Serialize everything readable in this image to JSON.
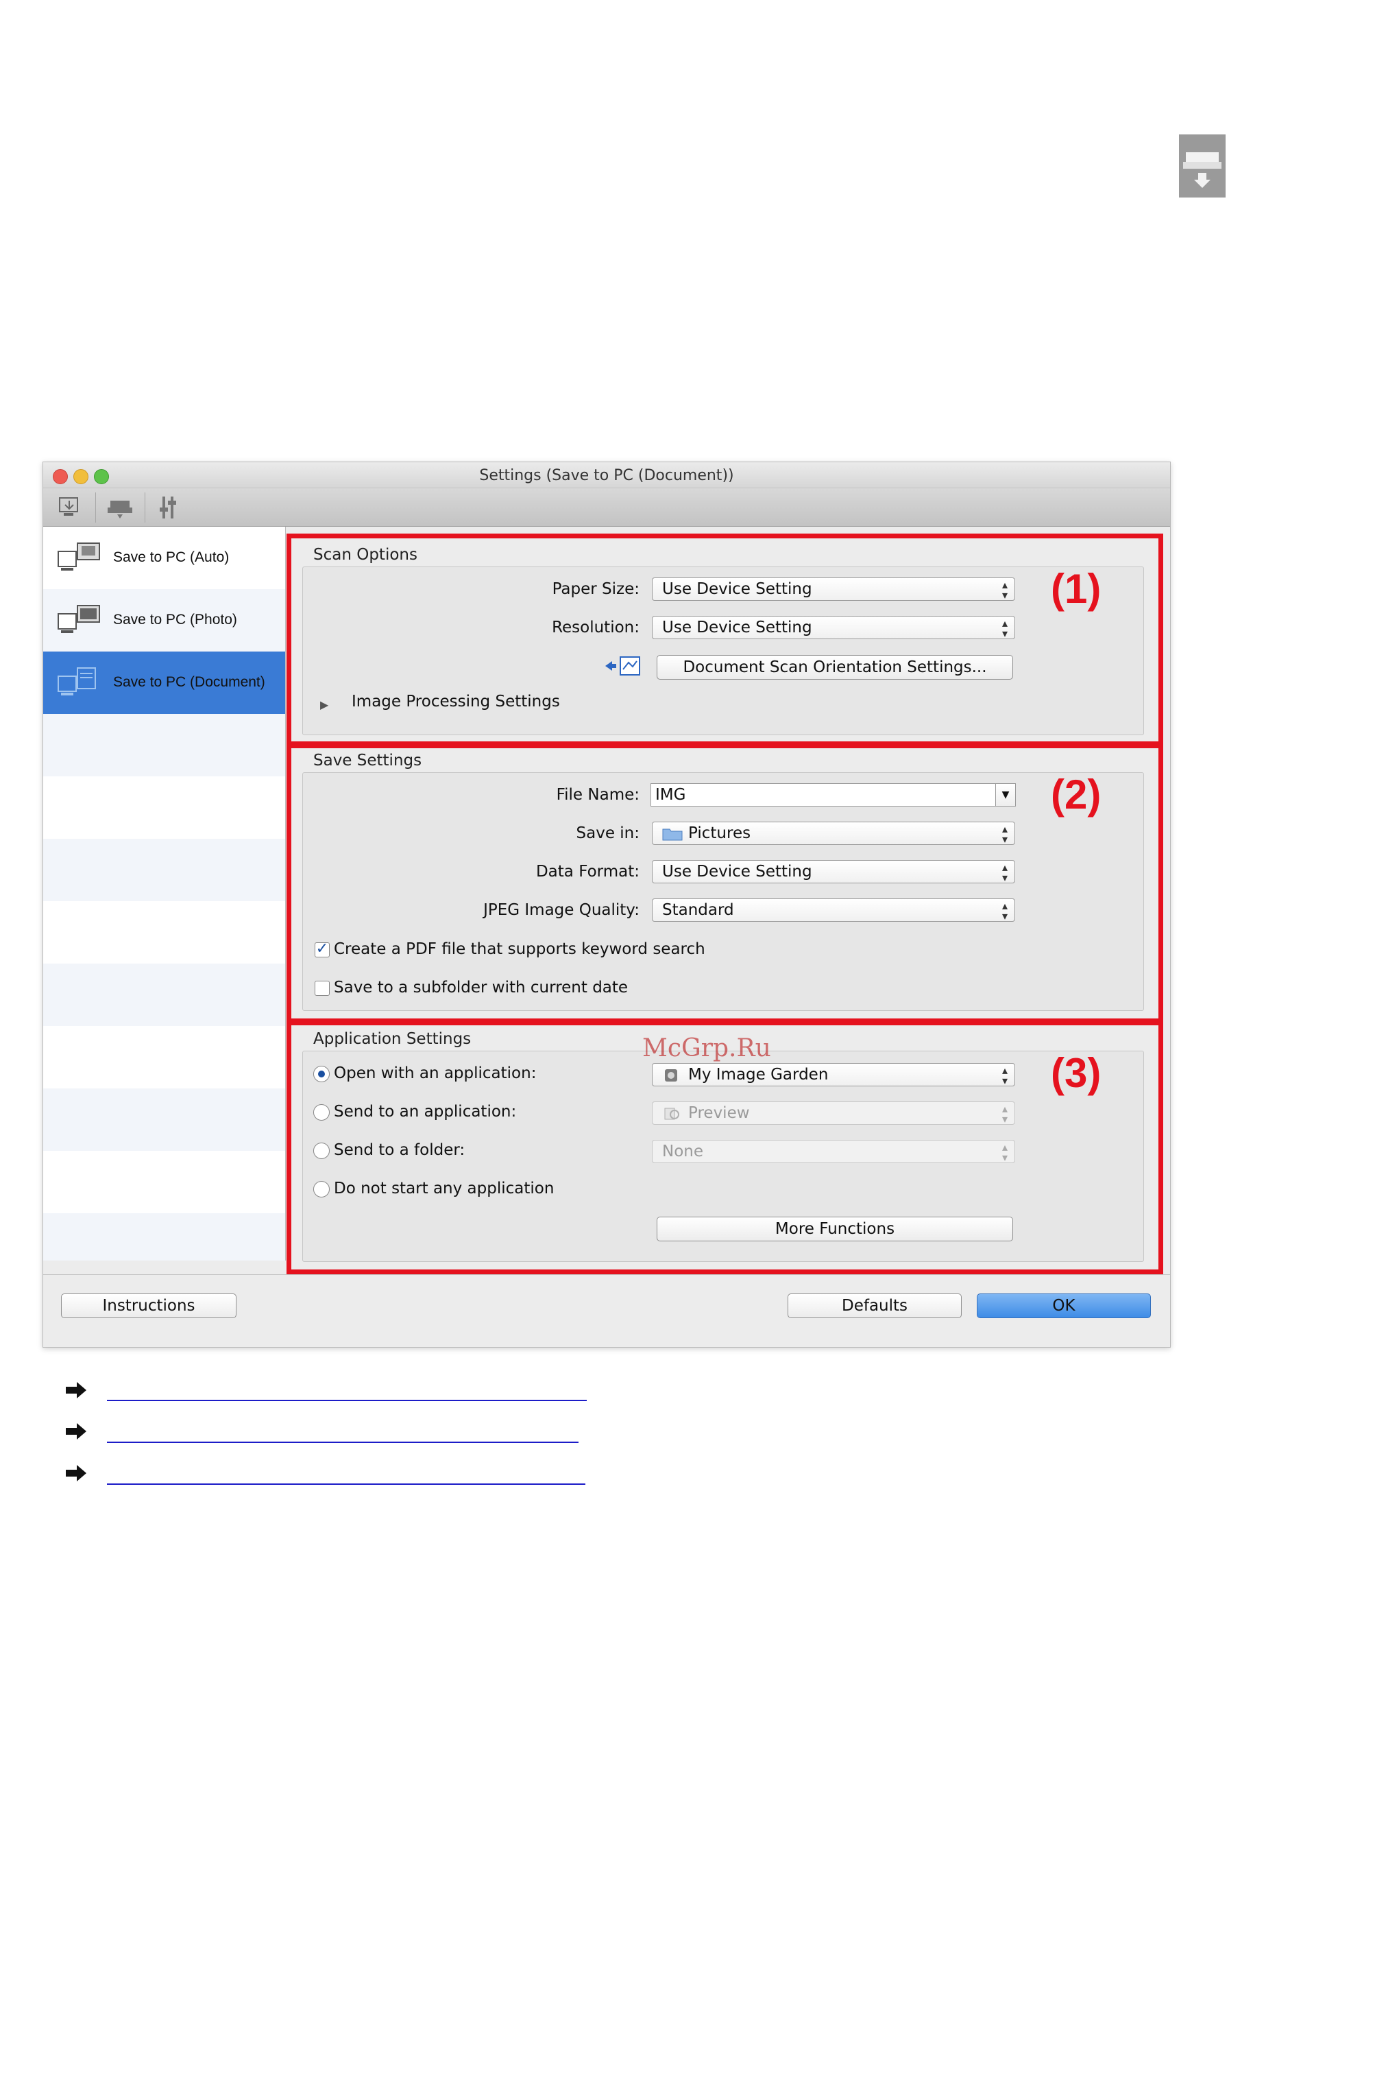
{
  "window": {
    "title": "Settings (Save to PC (Document))",
    "toolbar": [
      {
        "name": "scan-from-computer-tab-icon"
      },
      {
        "name": "scan-from-operation-panel-tab-icon"
      },
      {
        "name": "general-settings-tab-icon"
      }
    ]
  },
  "sidebar": {
    "items": [
      {
        "label": "Save to PC (Auto)",
        "selected": false
      },
      {
        "label": "Save to PC (Photo)",
        "selected": false
      },
      {
        "label": "Save to PC (Document)",
        "selected": true
      }
    ]
  },
  "scan_options": {
    "title": "Scan Options",
    "paper_size_label": "Paper Size:",
    "paper_size_value": "Use Device Setting",
    "resolution_label": "Resolution:",
    "resolution_value": "Use Device Setting",
    "orientation_button": "Document Scan Orientation Settings...",
    "image_processing_label": "Image Processing Settings",
    "marker": "(1)"
  },
  "save_settings": {
    "title": "Save Settings",
    "file_name_label": "File Name:",
    "file_name_value": "IMG",
    "save_in_label": "Save in:",
    "save_in_value": "Pictures",
    "data_format_label": "Data Format:",
    "data_format_value": "Use Device Setting",
    "jpeg_quality_label": "JPEG Image Quality:",
    "jpeg_quality_value": "Standard",
    "pdf_keyword_label": "Create a PDF file that supports keyword search",
    "pdf_keyword_checked": true,
    "subfolder_label": "Save to a subfolder with current date",
    "subfolder_checked": false,
    "marker": "(2)"
  },
  "application_settings": {
    "title": "Application Settings",
    "open_with_label": "Open with an application:",
    "open_with_value": "My Image Garden",
    "send_to_app_label": "Send to an application:",
    "send_to_app_value": "Preview",
    "send_to_folder_label": "Send to a folder:",
    "send_to_folder_value": "None",
    "no_app_label": "Do not start any application",
    "selected_option": "open_with",
    "more_functions_button": "More Functions",
    "marker": "(3)"
  },
  "footer": {
    "instructions_button": "Instructions",
    "defaults_button": "Defaults",
    "ok_button": "OK"
  },
  "watermark": "McGrp.Ru",
  "colors": {
    "highlight_red": "#e5121e",
    "selection_blue": "#3a7bd5",
    "link_blue": "#1c1cc8"
  }
}
